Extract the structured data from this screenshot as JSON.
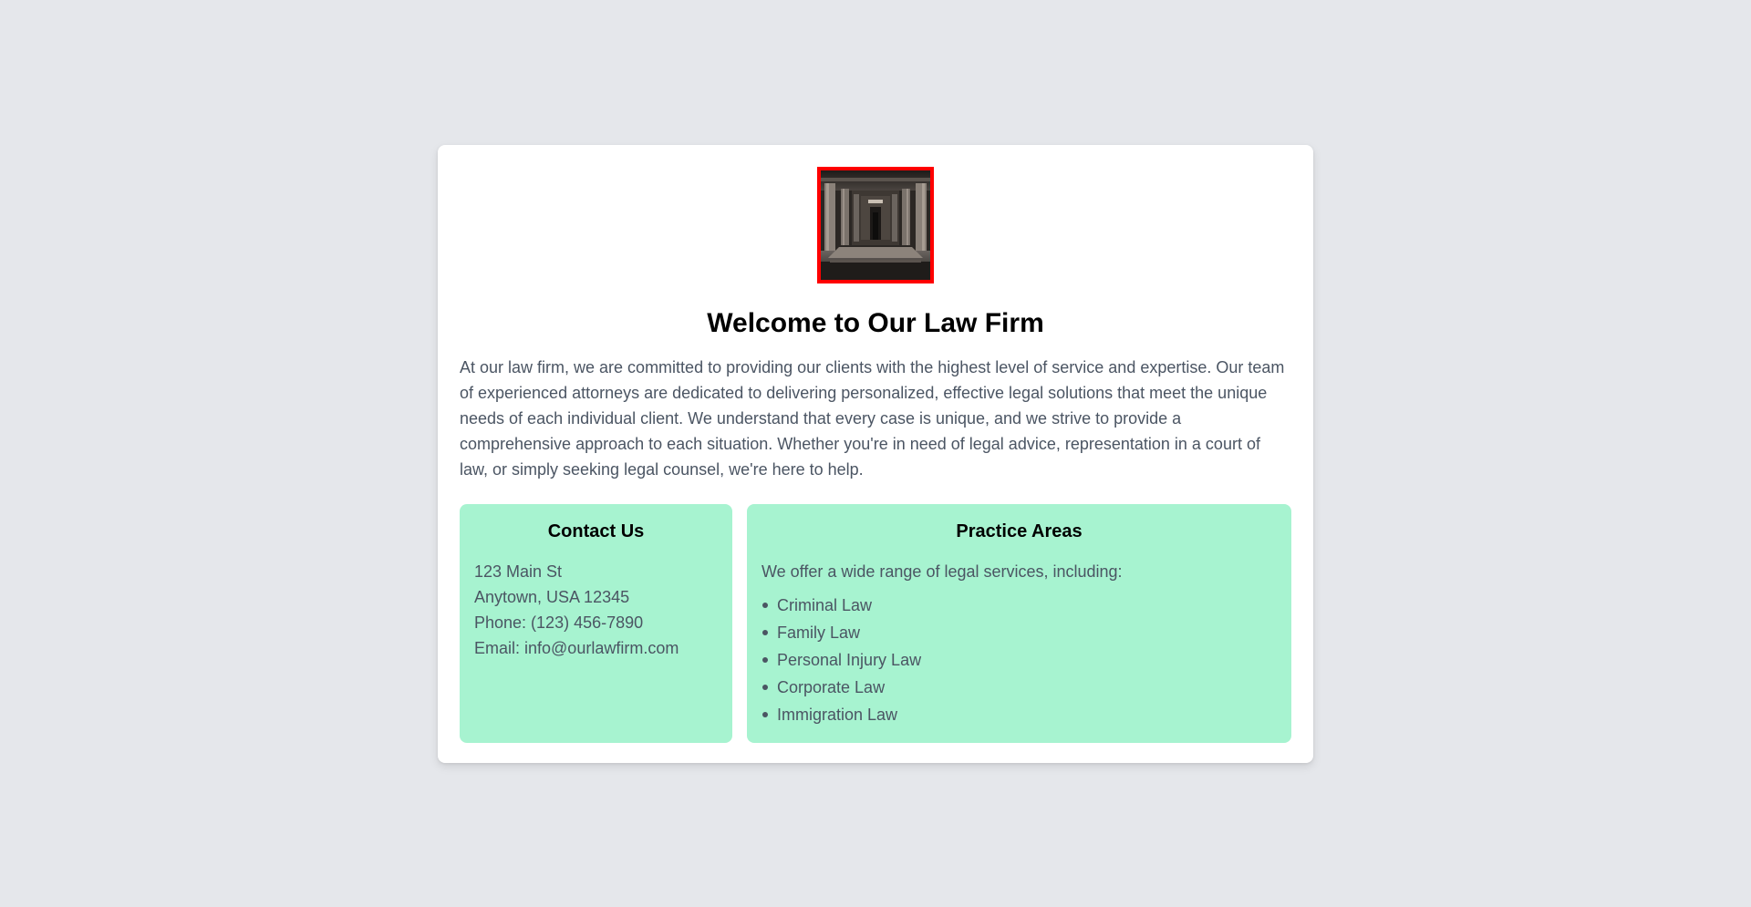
{
  "header": {
    "logo_name": "courthouse-hall-image",
    "title": "Welcome to Our Law Firm"
  },
  "intro": "At our law firm, we are committed to providing our clients with the highest level of service and expertise. Our team of experienced attorneys are dedicated to delivering personalized, effective legal solutions that meet the unique needs of each individual client. We understand that every case is unique, and we strive to provide a comprehensive approach to each situation. Whether you're in need of legal advice, representation in a court of law, or simply seeking legal counsel, we're here to help.",
  "contact": {
    "heading": "Contact Us",
    "lines": [
      "123 Main St",
      "Anytown, USA 12345",
      "Phone: (123) 456-7890",
      "Email: info@ourlawfirm.com"
    ]
  },
  "practice": {
    "heading": "Practice Areas",
    "description": "We offer a wide range of legal services, including:",
    "items": [
      "Criminal Law",
      "Family Law",
      "Personal Injury Law",
      "Corporate Law",
      "Immigration Law"
    ]
  },
  "colors": {
    "background": "#e5e7eb",
    "card": "#ffffff",
    "panel": "#a7f3d0",
    "logo_border": "#ff0000",
    "text_muted": "#4b5563"
  }
}
